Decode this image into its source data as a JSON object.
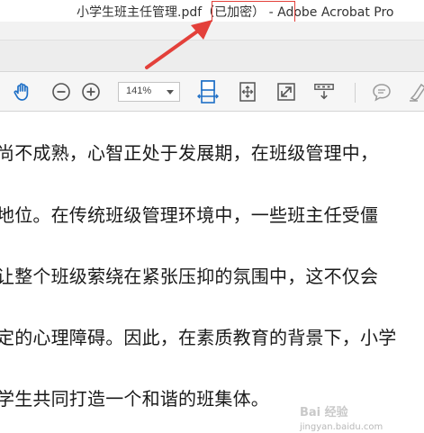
{
  "window": {
    "filename": "小学生班主任管理.pdf",
    "encrypted_tag": "（已加密）",
    "app_name": " - Adobe Acrobat Pro"
  },
  "toolbar": {
    "zoom_value": "141%",
    "tools": [
      "hand-icon",
      "zoom-out-icon",
      "zoom-in-icon",
      "fit-width-icon",
      "fit-page-icon",
      "full-screen-icon",
      "read-mode-icon",
      "comment-icon",
      "highlight-pen-icon"
    ]
  },
  "document": {
    "lines": [
      "尚不成熟，心智正处于发展期，在班级管理中，",
      "地位。在传统班级管理环境中，一些班主任受僵",
      "让整个班级萦绕在紧张压抑的氛围中，这不仅会",
      "定的心理障碍。因此，在素质教育的背景下，小学",
      "学生共同打造一个和谐的班集体。"
    ]
  },
  "watermark": {
    "text": "Bai 经验",
    "sub": "jingyan.baidu.com"
  },
  "colors": {
    "annotation": "#e3403a",
    "icon_blue": "#1e6fc6",
    "icon_gray": "#9a9a9a"
  }
}
